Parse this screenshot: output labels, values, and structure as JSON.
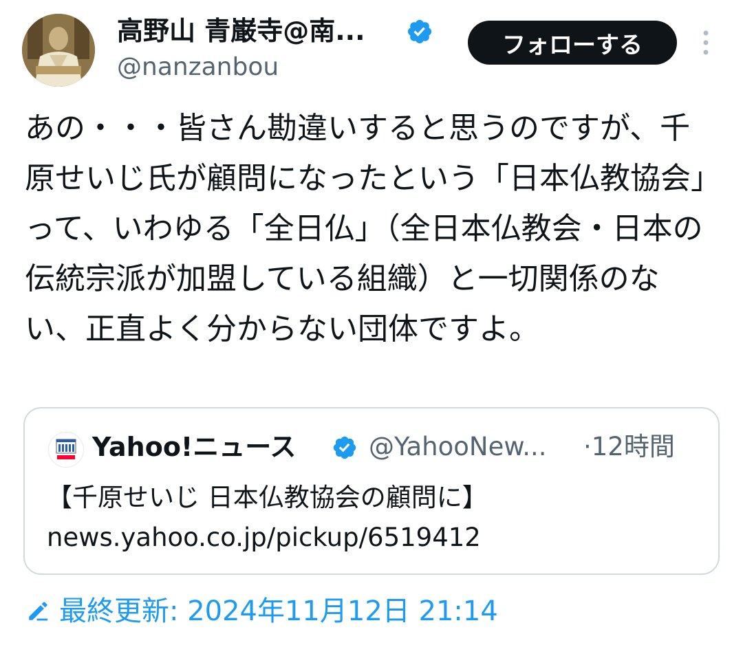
{
  "author": {
    "display_name": "高野山 青巌寺@南...",
    "handle": "@nanzanbou"
  },
  "follow_button_label": "フォローする",
  "tweet_text": "あの・・・皆さん勘違いすると思うのですが、千原せいじ氏が顧問になったという「日本仏教協会」って、いわゆる「全日仏」（全日本仏教会・日本の伝統宗派が加盟している組織）と一切関係のない、正直よく分からない団体ですよ。",
  "quoted_post": {
    "name": "Yahoo!ニュース",
    "handle": "@YahooNew...",
    "time": "·12時間",
    "title": "【千原せいじ 日本仏教協会の顧問に】",
    "link": "news.yahoo.co.jp/pickup/6519412"
  },
  "edited_label": "最終更新: 2024年11月12日 21:14",
  "colors": {
    "verified": "#1d9bf0",
    "link": "#1d9bf0",
    "secondary_text": "#536471",
    "border": "#cfd9de",
    "button": "#0f1419"
  },
  "icons": {
    "verified": "verified-badge-icon",
    "more": "more-dots-icon",
    "edit": "pencil-edit-icon"
  }
}
